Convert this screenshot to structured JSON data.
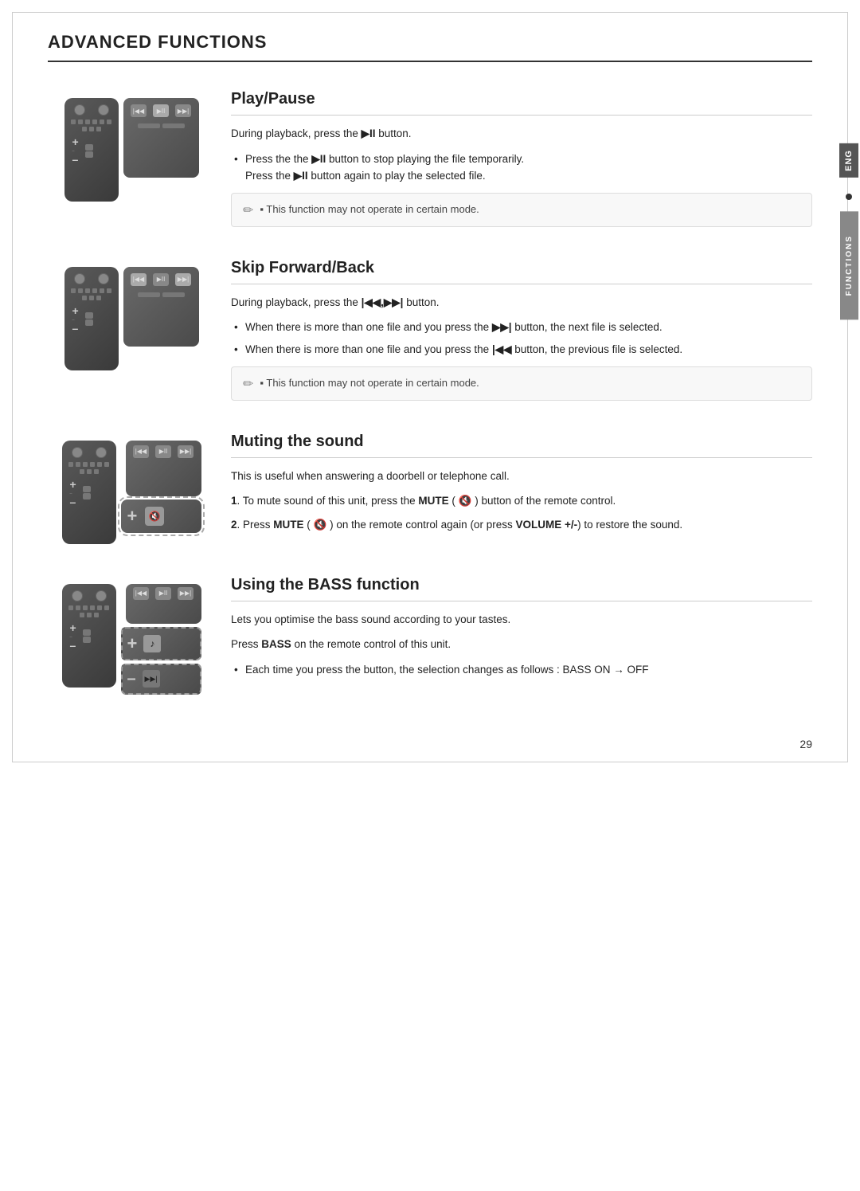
{
  "page": {
    "title": "ADVANCED FUNCTIONS",
    "page_number": "29",
    "sidebar_eng": "ENG",
    "sidebar_functions": "FUNCTIONS"
  },
  "sections": [
    {
      "id": "play-pause",
      "title": "Play/Pause",
      "desc_main": "During playback, press the ▶II button.",
      "bullets": [
        "Press the ▶II button to stop playing the file temporarily. Press the ▶II button again to play the selected file."
      ],
      "note": "This function may not operate in certain mode."
    },
    {
      "id": "skip-forward-back",
      "title": "Skip Forward/Back",
      "desc_main": "During playback, press the |◀◀,▶▶| button.",
      "bullets": [
        "When there is more than one file and you press the ▶▶| button, the next file is selected.",
        "When there is more than one file and you press the |◀◀ button, the previous file is selected."
      ],
      "note": "This function may not operate in certain mode."
    },
    {
      "id": "muting-sound",
      "title": "Muting the sound",
      "desc_main": "This is useful when answering a doorbell or telephone call.",
      "numbered": [
        "To mute sound of this unit, press the MUTE ( 🔇 ) button of the remote control.",
        "Press MUTE ( 🔇 ) on the remote control again (or press VOLUME +/- ) to restore the sound."
      ],
      "note": null
    },
    {
      "id": "bass-function",
      "title": "Using the BASS function",
      "desc_main": "Lets you optimise the bass sound according to your tastes.",
      "desc_2": "Press BASS on the remote control of this unit.",
      "bullets": [
        "Each time you press the button, the selection changes as follows : BASS ON → OFF"
      ],
      "note": null
    }
  ],
  "labels": {
    "mute_bold": "MUTE",
    "volume_bold": "VOLUME +/-",
    "bass_bold": "BASS",
    "note_text_1": "This function may not operate in certain mode.",
    "note_text_2": "This function may not operate in certain mode.",
    "press_the": "Press the"
  }
}
